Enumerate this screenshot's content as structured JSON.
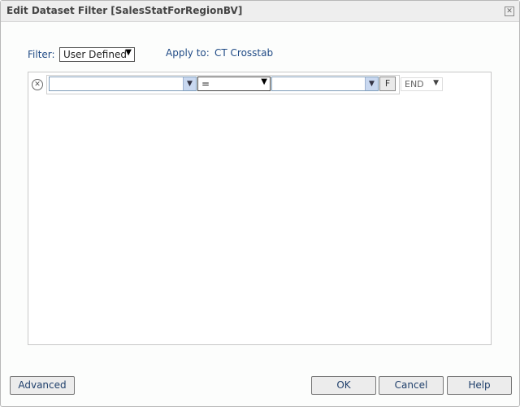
{
  "dialog": {
    "title": "Edit Dataset Filter [SalesStatForRegionBV]",
    "close_icon": "close-icon"
  },
  "filter": {
    "label": "Filter:",
    "value": "User Defined",
    "apply_label": "Apply to:",
    "apply_value": "CT Crosstab"
  },
  "condition": {
    "field": "",
    "operator": "=",
    "value": "",
    "f_label": "F",
    "logic": "END"
  },
  "buttons": {
    "advanced": "Advanced",
    "ok": "OK",
    "cancel": "Cancel",
    "help": "Help"
  }
}
